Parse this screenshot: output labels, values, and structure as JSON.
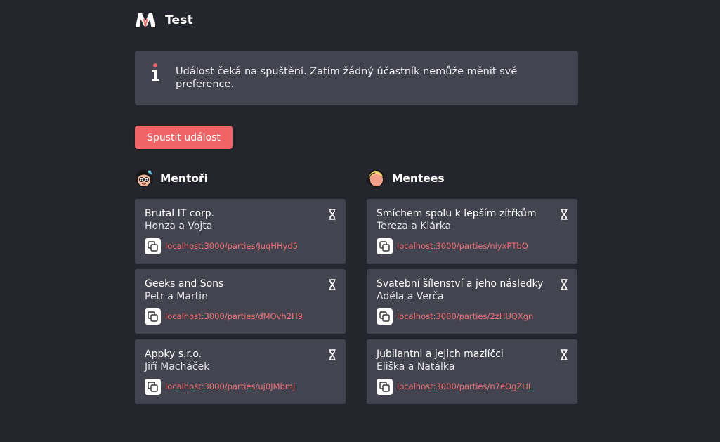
{
  "header": {
    "logo_icon": "m-logo-icon",
    "title": "Test"
  },
  "info": {
    "icon": "info-icon",
    "message": "Událost čeká na spuštění. Zatím žádný účastník nemůže měnit své preference."
  },
  "start_button": {
    "label": "Spustit událost"
  },
  "mentors": {
    "heading": "Mentoři",
    "icon": "mentor-avatar-icon",
    "parties": [
      {
        "name": "Brutal IT corp.",
        "members": "Honza a Vojta",
        "link": "localhost:3000/parties/JuqHHyd5",
        "status_icon": "hourglass-icon"
      },
      {
        "name": "Geeks and Sons",
        "members": "Petr a Martin",
        "link": "localhost:3000/parties/dMOvh2H9",
        "status_icon": "hourglass-icon"
      },
      {
        "name": "Appky s.r.o.",
        "members": "Jiří Macháček",
        "link": "localhost:3000/parties/uj0JMbmj",
        "status_icon": "hourglass-icon"
      }
    ]
  },
  "mentees": {
    "heading": "Mentees",
    "icon": "mentee-avatar-icon",
    "parties": [
      {
        "name": "Smíchem spolu k lepším zítřkům",
        "members": "Tereza a Klárka",
        "link": "localhost:3000/parties/niyxPTbO",
        "status_icon": "hourglass-icon"
      },
      {
        "name": "Svatební šílenství a jeho následky",
        "members": "Adéla a Verča",
        "link": "localhost:3000/parties/2zHUQXgn",
        "status_icon": "hourglass-icon"
      },
      {
        "name": "Jubilantni a jejich mazlíčci",
        "members": "Eliška a Natálka",
        "link": "localhost:3000/parties/n7eOgZHL",
        "status_icon": "hourglass-icon"
      }
    ]
  },
  "colors": {
    "background": "#24252d",
    "card": "#43444f",
    "accent": "#f06467",
    "link": "#f07174"
  }
}
